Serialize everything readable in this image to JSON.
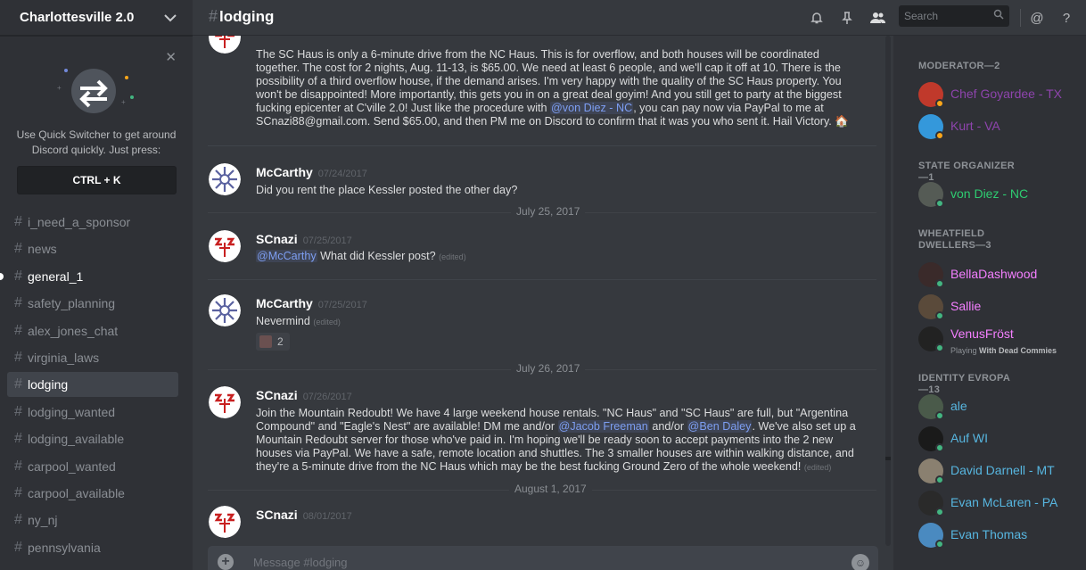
{
  "guild": {
    "name": "Charlottesville 2.0"
  },
  "quick_switcher": {
    "text_line1": "Use Quick Switcher to get around",
    "text_line2": "Discord quickly. Just press:",
    "shortcut": "CTRL + K"
  },
  "channels": [
    {
      "name": "i_need_a_sponsor",
      "state": "normal"
    },
    {
      "name": "news",
      "state": "normal"
    },
    {
      "name": "general_1",
      "state": "unread"
    },
    {
      "name": "safety_planning",
      "state": "normal"
    },
    {
      "name": "alex_jones_chat",
      "state": "normal"
    },
    {
      "name": "virginia_laws",
      "state": "normal"
    },
    {
      "name": "lodging",
      "state": "active"
    },
    {
      "name": "lodging_wanted",
      "state": "normal"
    },
    {
      "name": "lodging_available",
      "state": "normal"
    },
    {
      "name": "carpool_wanted",
      "state": "normal"
    },
    {
      "name": "carpool_available",
      "state": "normal"
    },
    {
      "name": "ny_nj",
      "state": "normal"
    },
    {
      "name": "pennsylvania",
      "state": "normal"
    }
  ],
  "header": {
    "channel": "lodging",
    "search_placeholder": "Search"
  },
  "messages": {
    "m1": {
      "author": "SCnazi",
      "text_a": "The SC Haus is only a 6-minute drive from the NC Haus. This is for overflow, and both houses will be coordinated together. The cost for 2 nights, Aug. 11-13, is $65.00. We need at least 6 people, and we'll cap it off at 10. There is the possibility of a third overflow house, if the demand arises. I'm very happy with the quality of the SC Haus property. You won't be disappointed! More importantly, this gets you in on a great deal goyim! And you still get to party at the biggest fucking epicenter at C'ville 2.0! Just like the procedure with ",
      "mention": "@von Diez - NC",
      "text_b": ", you can pay now via PayPal to me at SCnazi88@gmail.com. Send $65.00, and then PM me on Discord to confirm that it was you who sent it. Hail Victory. 🏠"
    },
    "m2": {
      "author": "McCarthy",
      "time": "07/24/2017",
      "text": "Did you rent the place Kessler posted the other day?"
    },
    "d1": "July 25, 2017",
    "m3": {
      "author": "SCnazi",
      "time": "07/25/2017",
      "mention": "@McCarthy",
      "text": " What did Kessler post?",
      "edited": "(edited)"
    },
    "m4": {
      "author": "McCarthy",
      "time": "07/25/2017",
      "text": "Nevermind",
      "edited": "(edited)",
      "reaction_count": "2"
    },
    "d2": "July 26, 2017",
    "m5": {
      "author": "SCnazi",
      "time": "07/26/2017",
      "t1": "Join the Mountain Redoubt! We have 4 large weekend house rentals. \"NC Haus\" and \"SC Haus\" are full, but \"Argentina Compound\" and \"Eagle's Nest\" are available! DM me and/or ",
      "mention1": "@Jacob Freeman",
      "t2": " and/or ",
      "mention2": "@Ben Daley",
      "t3": ". We've also set up a Mountain Redoubt server for those who've paid in. I'm hoping we'll be ready soon to accept payments into the 2 new houses via PayPal. We have a safe, remote location and shuttles. The 3 smaller houses are within walking distance, and they're a 5-minute drive from the NC Haus which may be the best fucking Ground Zero of the whole weekend! ",
      "edited": "(edited)"
    },
    "d3": "August 1, 2017",
    "m6": {
      "author": "SCnazi",
      "time": "08/01/2017"
    }
  },
  "composer": {
    "placeholder": "Message #lodging"
  },
  "members": {
    "roles": [
      {
        "title": "MODERATOR—2",
        "members": [
          {
            "name": "Chef Goyardee - TX",
            "color": "#8e44ad",
            "status": "#faa61a",
            "avatar": "#c0392b"
          },
          {
            "name": "Kurt - VA",
            "color": "#8e44ad",
            "status": "#faa61a",
            "avatar": "#3498db"
          }
        ]
      },
      {
        "title": "STATE ORGANIZER—1",
        "members": [
          {
            "name": "von Diez - NC",
            "color": "#2ecc71",
            "status": "#43b581",
            "avatar": "#555b55"
          }
        ]
      },
      {
        "title": "WHEATFIELD DWELLERS—3",
        "members": [
          {
            "name": "BellaDashwood",
            "color": "#f47fff",
            "status": "#43b581",
            "avatar": "#3a2a2a"
          },
          {
            "name": "Sallie",
            "color": "#f47fff",
            "status": "#43b581",
            "avatar": "#5a4a3a"
          },
          {
            "name": "VenusFröst",
            "color": "#f47fff",
            "status": "#43b581",
            "avatar": "#222222",
            "activity_prefix": "Playing ",
            "activity": "With Dead Commies"
          }
        ]
      },
      {
        "title": "IDENTITY EVROPA—13",
        "members": [
          {
            "name": "ale",
            "color": "#57b6e0",
            "status": "#43b581",
            "avatar": "#4a5a4a"
          },
          {
            "name": "Auf WI",
            "color": "#57b6e0",
            "status": "#43b581",
            "avatar": "#1a1a1a"
          },
          {
            "name": "David Darnell - MT",
            "color": "#57b6e0",
            "status": "#43b581",
            "avatar": "#8a8070"
          },
          {
            "name": "Evan McLaren - PA",
            "color": "#57b6e0",
            "status": "#43b581",
            "avatar": "#2a2a2a"
          },
          {
            "name": "Evan Thomas",
            "color": "#57b6e0",
            "status": "#43b581",
            "avatar": "#4a8ac0"
          }
        ]
      }
    ]
  }
}
